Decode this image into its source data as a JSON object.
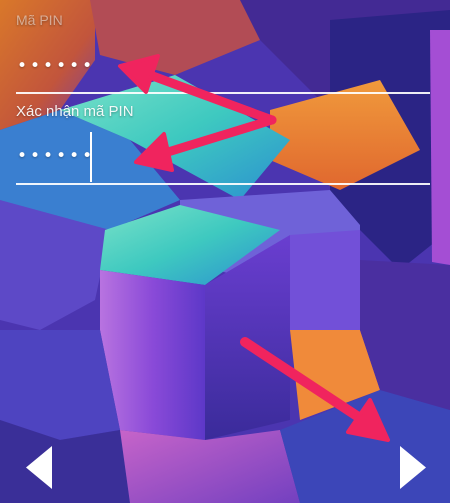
{
  "pin_field": {
    "label": "Mã PIN",
    "value": "••••••"
  },
  "confirm_field": {
    "label": "Xác nhận mã PIN",
    "value": "••••••"
  },
  "navigation": {
    "prev_icon": "chevron-left-triangle",
    "next_icon": "chevron-right-triangle"
  },
  "colors": {
    "annotation_arrow": "#f0245e",
    "text": "#ffffff"
  }
}
